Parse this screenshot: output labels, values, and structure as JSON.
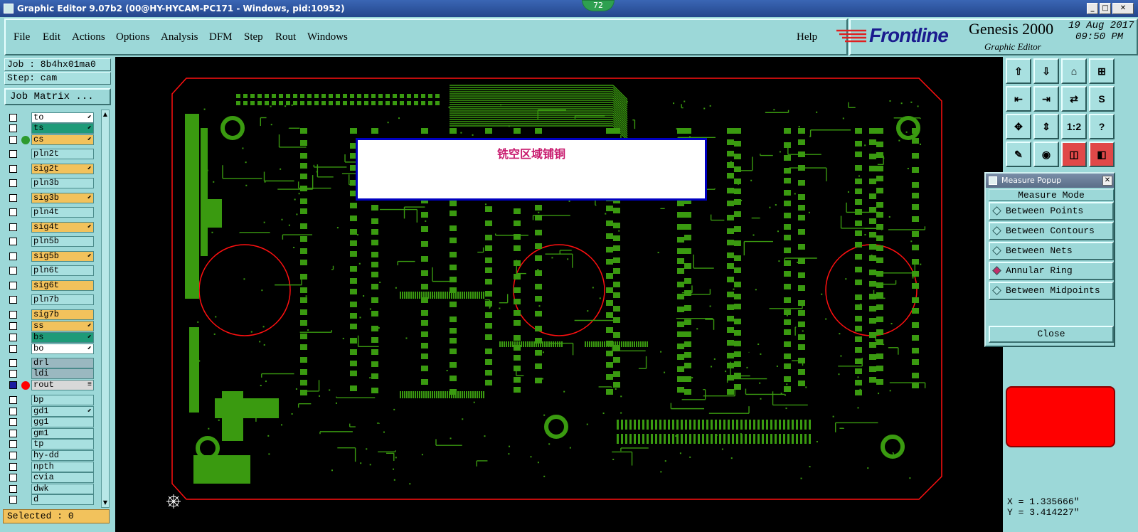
{
  "window": {
    "title": "Graphic Editor 9.07b2 (00@HY-HYCAM-PC171 - Windows, pid:10952)",
    "badge": "72",
    "minimize": "_",
    "maximize": "□",
    "close": "✕"
  },
  "menu": {
    "items": [
      "File",
      "Edit",
      "Actions",
      "Options",
      "Analysis",
      "DFM",
      "Step",
      "Rout",
      "Windows"
    ],
    "help": "Help"
  },
  "brand": {
    "logo": "Frontline",
    "product": "Genesis 2000",
    "subtitle": "Graphic Editor",
    "date": "19 Aug 2017",
    "time": "09:50 PM"
  },
  "job": {
    "job_label": "Job : 8b4hx01ma0",
    "step_label": "Step: cam",
    "matrix_button": "Job Matrix ..."
  },
  "layers": [
    {
      "name": "to",
      "bg": "#ffffff",
      "mark": "⬋"
    },
    {
      "name": "ts",
      "bg": "#1e9a78",
      "mark": "⬋"
    },
    {
      "name": "cs",
      "bg": "#f2c25c",
      "mark": "⬋",
      "dot": "#2e9a2e"
    },
    {
      "name": "pln2t",
      "bg": "#a8e0e0",
      "mark": ""
    },
    {
      "name": "sig2t",
      "bg": "#f2c25c",
      "mark": "⬋"
    },
    {
      "name": "pln3b",
      "bg": "#a8e0e0",
      "mark": ""
    },
    {
      "name": "sig3b",
      "bg": "#f2c25c",
      "mark": "⬋"
    },
    {
      "name": "pln4t",
      "bg": "#a8e0e0",
      "mark": ""
    },
    {
      "name": "sig4t",
      "bg": "#f2c25c",
      "mark": "⬋"
    },
    {
      "name": "pln5b",
      "bg": "#a8e0e0",
      "mark": ""
    },
    {
      "name": "sig5b",
      "bg": "#f2c25c",
      "mark": "⬋"
    },
    {
      "name": "pln6t",
      "bg": "#a8e0e0",
      "mark": ""
    },
    {
      "name": "sig6t",
      "bg": "#f2c25c",
      "mark": ""
    },
    {
      "name": "pln7b",
      "bg": "#a8e0e0",
      "mark": ""
    },
    {
      "name": "sig7b",
      "bg": "#f2c25c",
      "mark": ""
    },
    {
      "name": "ss",
      "bg": "#f2c25c",
      "mark": "⬋"
    },
    {
      "name": "bs",
      "bg": "#1e9a78",
      "mark": "⬋"
    },
    {
      "name": "bo",
      "bg": "#ffffff",
      "mark": "⬋"
    },
    {
      "name": "drl",
      "bg": "#9ab8c0",
      "mark": ""
    },
    {
      "name": "ldi",
      "bg": "#9ab8c0",
      "mark": ""
    },
    {
      "name": "rout",
      "bg": "#d8d8d8",
      "mark": "≡",
      "dot": "#ff0000"
    },
    {
      "name": "bp",
      "bg": "#a8e0e0",
      "mark": ""
    },
    {
      "name": "gd1",
      "bg": "#a8e0e0",
      "mark": "⬋"
    },
    {
      "name": "gg1",
      "bg": "#a8e0e0",
      "mark": ""
    },
    {
      "name": "gm1",
      "bg": "#a8e0e0",
      "mark": ""
    },
    {
      "name": "tp",
      "bg": "#a8e0e0",
      "mark": ""
    },
    {
      "name": "hy-dd",
      "bg": "#a8e0e0",
      "mark": ""
    },
    {
      "name": "npth",
      "bg": "#a8e0e0",
      "mark": ""
    },
    {
      "name": "cvia",
      "bg": "#a8e0e0",
      "mark": ""
    },
    {
      "name": "dwk",
      "bg": "#a8e0e0",
      "mark": ""
    },
    {
      "name": "d",
      "bg": "#a8e0e0",
      "mark": ""
    }
  ],
  "selected": "Selected : 0",
  "annotation": "铣空区域铺铜",
  "toolbar": [
    {
      "glyph": "⇧",
      "icon": "zoom-home-icon"
    },
    {
      "glyph": "⇩",
      "icon": "zoom-down-icon"
    },
    {
      "glyph": "⌂",
      "icon": "home-icon"
    },
    {
      "glyph": "⊞",
      "icon": "grid-icon"
    },
    {
      "glyph": "⇤",
      "icon": "pan-left-icon"
    },
    {
      "glyph": "⇥",
      "icon": "pan-right-icon"
    },
    {
      "glyph": "⇄",
      "icon": "swap-icon"
    },
    {
      "glyph": "S",
      "icon": "snap-icon"
    },
    {
      "glyph": "✥",
      "icon": "zoom-fit-icon"
    },
    {
      "glyph": "⇕",
      "icon": "zoom-area-icon"
    },
    {
      "glyph": "1:2",
      "icon": "scale-icon"
    },
    {
      "glyph": "?",
      "icon": "help-icon"
    },
    {
      "glyph": "✎",
      "icon": "edit-icon"
    },
    {
      "glyph": "◉",
      "icon": "target-icon"
    },
    {
      "glyph": "◫",
      "icon": "net-icon"
    },
    {
      "glyph": "◧",
      "icon": "layer-icon"
    }
  ],
  "measure": {
    "title": "Measure Popup",
    "mode_label": "Measure Mode",
    "options": [
      "Between Points",
      "Between Contours",
      "Between Nets",
      "Annular Ring",
      "Between Midpoints"
    ],
    "selected_option": "Annular Ring",
    "close_button": "Close"
  },
  "coords": {
    "x": "X = 1.335666\"",
    "y": "Y = 3.414227\""
  }
}
